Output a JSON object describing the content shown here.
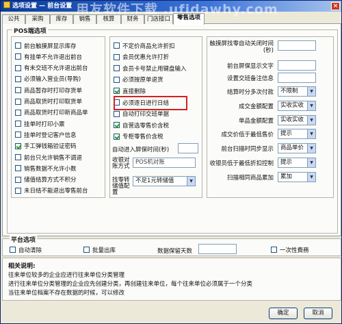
{
  "window": {
    "title": "选项设置 — 前台设置"
  },
  "watermark": "用友软件下载 .ufidawhy.com",
  "tabs": [
    "公共",
    "采购",
    "库存",
    "销售",
    "核算",
    "财务",
    "门店接口",
    "零售选项"
  ],
  "pos_group": {
    "title": "POS端选项",
    "left": [
      {
        "label": "前台触摸屏显示库存",
        "checked": false
      },
      {
        "label": "有挂单不允许退出前台",
        "checked": false
      },
      {
        "label": "有未交班不允许退出前台",
        "checked": false
      },
      {
        "label": "必须输入营业员(导购)",
        "checked": false
      },
      {
        "label": "商品暂存时打印存货单",
        "checked": false
      },
      {
        "label": "商品取货时打印取货单",
        "checked": false
      },
      {
        "label": "商品取货时打印新商品单",
        "checked": false
      },
      {
        "label": "挂单时打印小票",
        "checked": false
      },
      {
        "label": "挂单时登记客户信息",
        "checked": false
      },
      {
        "label": "手工弹钱箱验证密码",
        "checked": true
      },
      {
        "label": "前台只允许销售不调退",
        "checked": false
      },
      {
        "label": "销售数据不允许小数",
        "checked": false
      },
      {
        "label": "储值结算方式不积分",
        "checked": false
      },
      {
        "label": "未日结不能退出零售前台",
        "checked": false
      }
    ],
    "middle": [
      {
        "label": "不定价商品允许折扣",
        "checked": false
      },
      {
        "label": "会员优惠允许打折",
        "checked": false
      },
      {
        "label": "会员卡号禁止用键盘输入",
        "checked": false
      },
      {
        "label": "必须按原单退货",
        "checked": false
      },
      {
        "label": "直接删除",
        "checked": true
      },
      {
        "label": "必须逐日进行日结",
        "checked": false
      },
      {
        "label": "自动打印交班单据",
        "checked": false
      },
      {
        "label": "自营选零售价含税",
        "checked": true
      },
      {
        "label": "专柜零售价含税",
        "checked": true
      }
    ],
    "auto_lock_label": "自动进入屏保时间(秒)",
    "auto_lock_value": "",
    "settle_mode_label": "收银对账方式",
    "settle_mode_value": "POS机对账",
    "change_label": "找零转储值配置",
    "change_value": "不足1元转储值",
    "right": [
      {
        "label": "触摸屏找零自动关闭时间(秒)",
        "type": "input",
        "value": ""
      },
      {
        "label": "前台屏保显示文字",
        "type": "input",
        "value": ""
      },
      {
        "label": "设置交班备注信息",
        "type": "input",
        "value": ""
      },
      {
        "label": "结算时分多次付款",
        "type": "select",
        "value": "不限制"
      },
      {
        "label": "成交金额配置",
        "type": "select",
        "value": "实收实收"
      },
      {
        "label": "单品金额配置",
        "type": "select",
        "value": "实收实收"
      },
      {
        "label": "成交价低于最低售价",
        "type": "select",
        "value": "提示"
      },
      {
        "label": "前台扫描时同步显示",
        "type": "select",
        "value": "商品单价"
      },
      {
        "label": "收银员低于最低折扣控制",
        "type": "select",
        "value": "提示"
      },
      {
        "label": "扫描相同商品累加",
        "type": "select",
        "value": "累加"
      }
    ]
  },
  "platform": {
    "title": "平台选项",
    "auto_clear": "自动清除",
    "batch_out": "批量出库",
    "days_label": "数据保留天数",
    "days_value": "",
    "one_time": "一次性費務"
  },
  "help": {
    "title": "相关说明:",
    "lines": [
      "往来单位较多的企业应进行往来单位分类管理",
      "进行往来单位分类管理的企业应先创建分类，再创建往来单位，每个往来单位必须属于一个分类",
      "当往来单位档案不存在数据的时候，可以修改"
    ]
  },
  "buttons": {
    "ok": "确定",
    "cancel": "取消"
  }
}
